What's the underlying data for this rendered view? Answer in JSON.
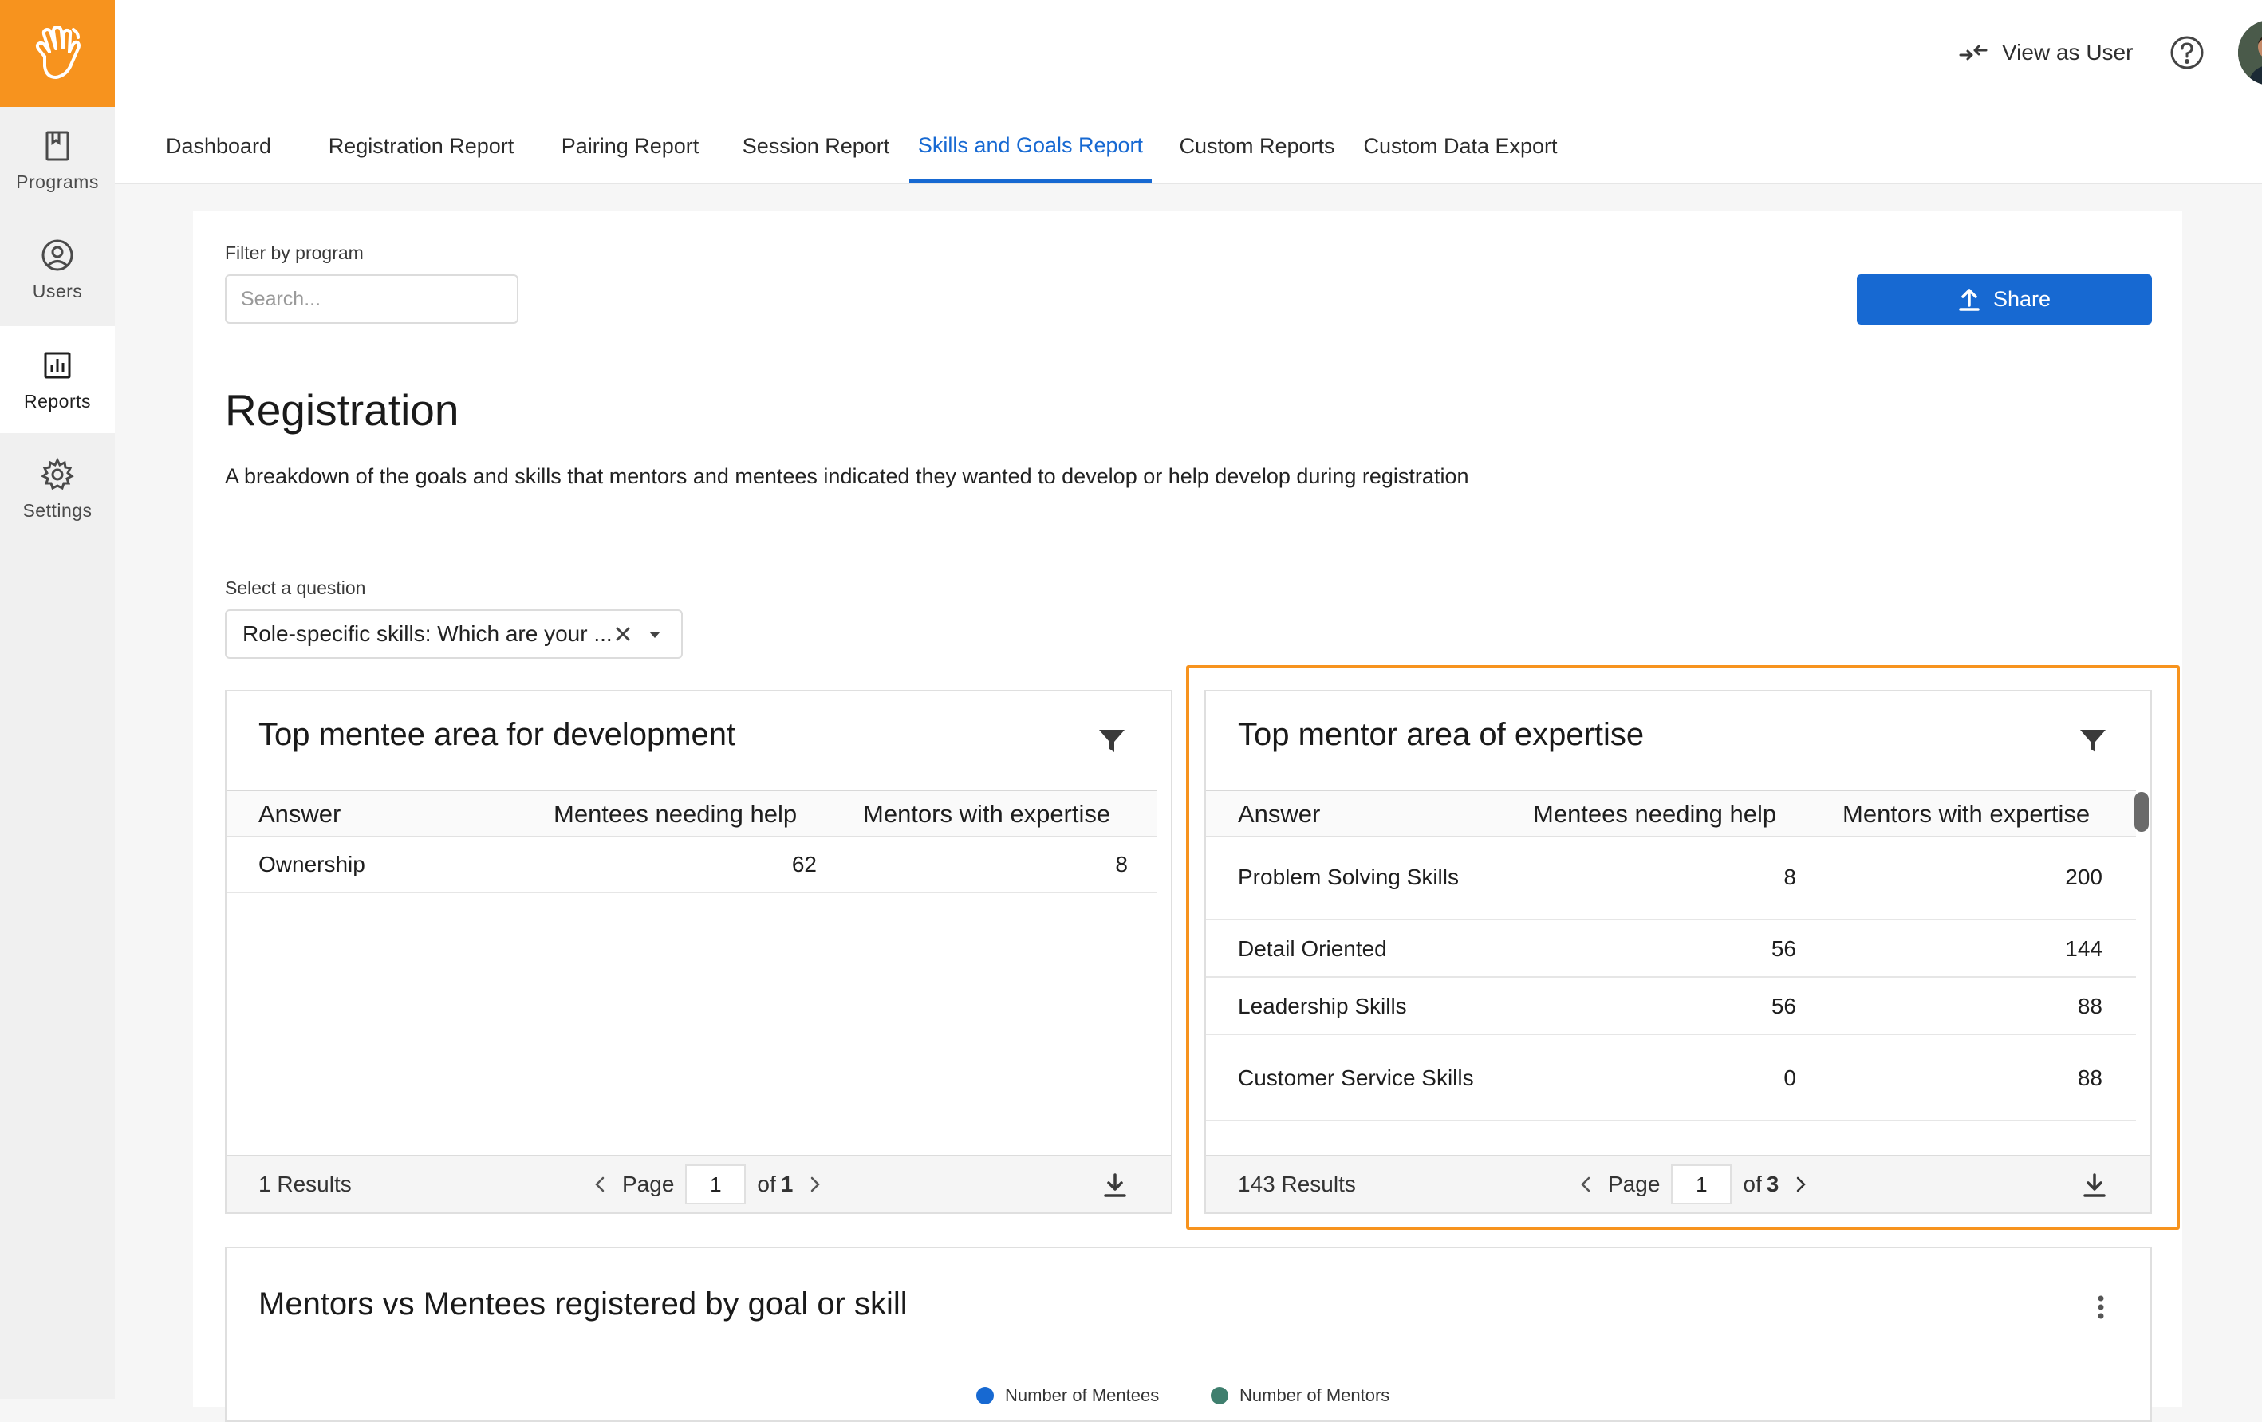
{
  "sidebar": {
    "items": [
      {
        "label": "Programs",
        "icon": "book-icon"
      },
      {
        "label": "Users",
        "icon": "user-circle-icon"
      },
      {
        "label": "Reports",
        "icon": "bar-chart-icon",
        "active": true
      },
      {
        "label": "Settings",
        "icon": "gear-icon"
      }
    ]
  },
  "header": {
    "view_as_user": "View as User"
  },
  "tabs": [
    {
      "label": "Dashboard"
    },
    {
      "label": "Registration Report"
    },
    {
      "label": "Pairing Report"
    },
    {
      "label": "Session Report"
    },
    {
      "label": "Skills and Goals Report",
      "active": true
    },
    {
      "label": "Custom Reports"
    },
    {
      "label": "Custom Data Export"
    }
  ],
  "filter": {
    "label": "Filter by program",
    "placeholder": "Search..."
  },
  "share_button": "Share",
  "section": {
    "title": "Registration",
    "description": "A breakdown of the goals and skills that mentors and mentees indicated they wanted to develop or help develop during registration"
  },
  "question": {
    "label": "Select a question",
    "value": "Role-specific skills: Which are your ..."
  },
  "mentee_table": {
    "title": "Top mentee area for development",
    "columns": [
      "Answer",
      "Mentees needing help",
      "Mentors with expertise"
    ],
    "rows": [
      {
        "answer": "Ownership",
        "mentees": "62",
        "mentors": "8"
      }
    ],
    "results": "1 Results",
    "page_label": "Page",
    "page": "1",
    "of_label": "of",
    "total_pages": "1"
  },
  "mentor_table": {
    "title": "Top mentor area of expertise",
    "columns": [
      "Answer",
      "Mentees needing help",
      "Mentors with expertise"
    ],
    "rows": [
      {
        "answer": "Problem Solving Skills",
        "mentees": "8",
        "mentors": "200"
      },
      {
        "answer": "Detail Oriented",
        "mentees": "56",
        "mentors": "144"
      },
      {
        "answer": "Leadership Skills",
        "mentees": "56",
        "mentors": "88"
      },
      {
        "answer": "Customer Service Skills",
        "mentees": "0",
        "mentors": "88"
      }
    ],
    "results": "143 Results",
    "page_label": "Page",
    "page": "1",
    "of_label": "of",
    "total_pages": "3"
  },
  "chart_card": {
    "title": "Mentors vs Mentees registered by goal or skill",
    "legend": [
      {
        "label": "Number of Mentees",
        "color": "#1769d2"
      },
      {
        "label": "Number of Mentors",
        "color": "#3f7f6e"
      }
    ]
  },
  "colors": {
    "accent": "#1769d2",
    "brand": "#f7931e"
  }
}
